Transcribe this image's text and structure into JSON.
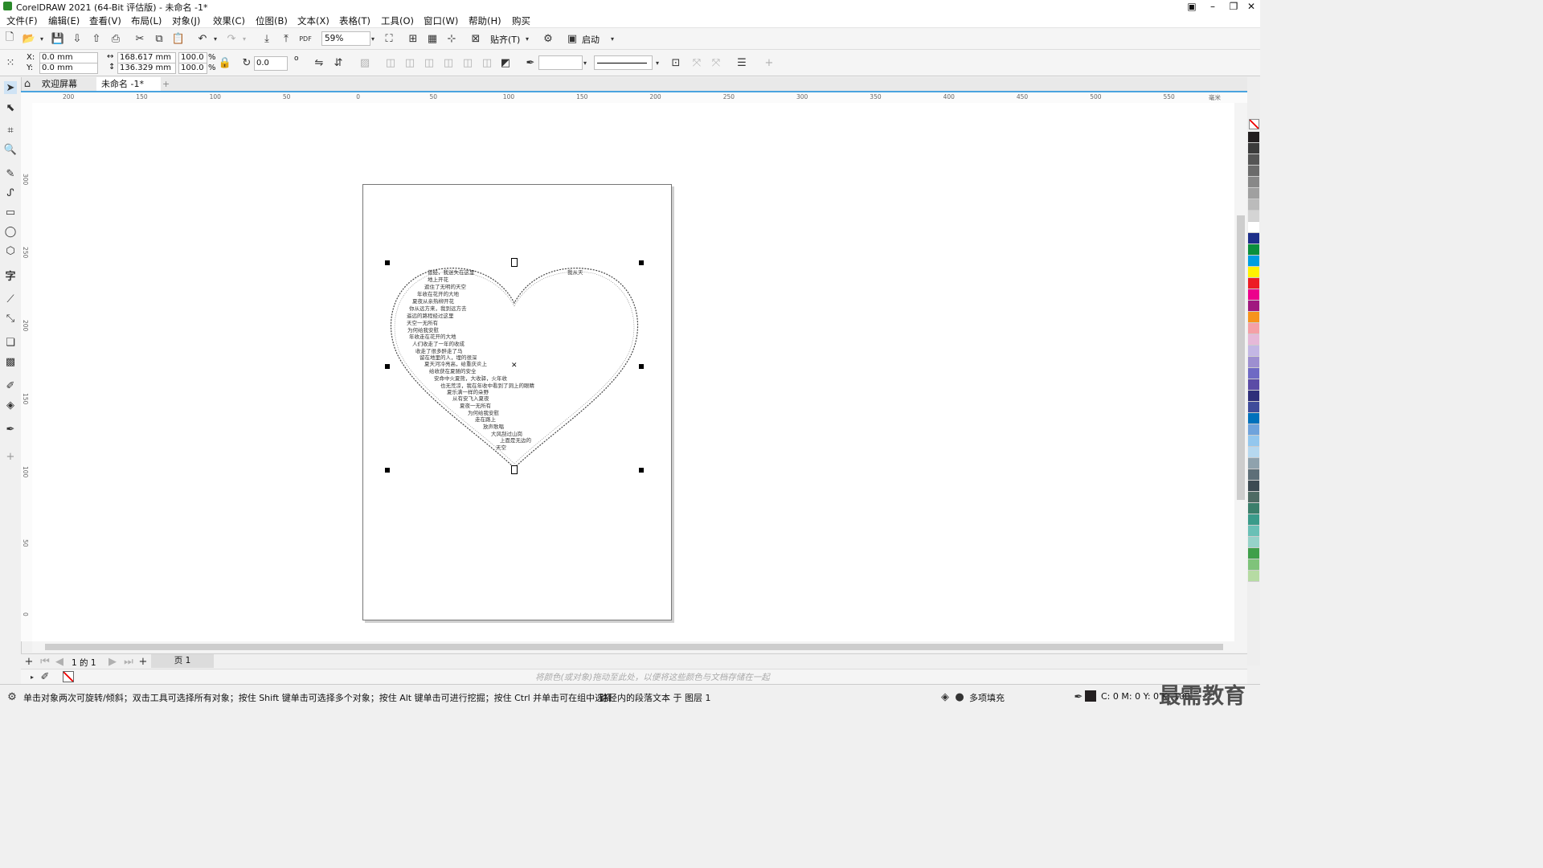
{
  "titlebar": {
    "title": "CorelDRAW 2021 (64-Bit 评估版) - 未命名 -1*"
  },
  "menus": [
    "文件(F)",
    "编辑(E)",
    "查看(V)",
    "布局(L)",
    "对象(J)",
    "效果(C)",
    "位图(B)",
    "文本(X)",
    "表格(T)",
    "工具(O)",
    "窗口(W)",
    "帮助(H)",
    "购买"
  ],
  "toolbar": {
    "zoom": "59%",
    "snap_label": "贴齐(T)",
    "launch_label": "启动"
  },
  "propbar": {
    "x_label": "X:",
    "x_value": "0.0 mm",
    "y_label": "Y:",
    "y_value": "0.0 mm",
    "width_value": "168.617 mm",
    "height_value": "136.329 mm",
    "scale_w": "100.0",
    "scale_h": "100.0",
    "percent": "%",
    "angle": "0.0",
    "degree": "o"
  },
  "tabs": {
    "welcome": "欢迎屏幕",
    "doc": "未命名 -1*",
    "add": "+"
  },
  "hruler_labels": [
    "200",
    "150",
    "100",
    "50",
    "0",
    "50",
    "100",
    "150",
    "200",
    "250",
    "300",
    "350",
    "400",
    "450",
    "500",
    "550",
    "毫米"
  ],
  "vruler_labels": [
    "300",
    "250",
    "200",
    "150",
    "100",
    "50",
    "0"
  ],
  "poem": {
    "lines": [
      "曾经，我迷失在这里",
      "地上开花",
      "遮住了无明的天空",
      "年收在花开的大地",
      "夏夜从亲热柳开花",
      "你从远方来，我到远方去",
      "遥远的路程经过这里",
      "天空一无所有",
      "为何给我安慰",
      "年收走在花开的大地",
      "人们收走了一年的收成",
      "收走了很多醉走了马",
      "留在地里的人，埋的很深",
      "夏天河冷亮高，给重庆炎上",
      "给收获在夏随的安全",
      "安命中火夏熊，大收驿，火年收",
      "也无荒凉，我在年收中看到了洞上的眼睛",
      "夏乐满一样的朵野",
      "从有安飞入夏夜",
      "夏夜一无所有",
      "为何给我安慰",
      "走在路上",
      "放声歌唱",
      "大风刮过山岗",
      "上面是无边的",
      "天空"
    ],
    "top_right": "我从天"
  },
  "pagenav": {
    "page_of": "1 的 1",
    "page_tab": "页 1"
  },
  "colorbar": {
    "hint": "将颜色(或对象)拖动至此处，以便将这些颜色与文档存储在一起"
  },
  "status": {
    "hint": "单击对象两次可旋转/倾斜；双击工具可选择所有对象；按住 Shift 键单击可选择多个对象；按住 Alt 键单击可进行挖掘；按住 Ctrl 并单击可在组中选择",
    "object_info": "路径内的段落文本 于 图层 1",
    "fill_label": "多项填充",
    "cmyk": "C: 0 M: 0 Y: 0 K: 100",
    "watermark": "最需教育"
  },
  "palette_colors": [
    "#231f20",
    "#3b3b3b",
    "#555",
    "#6b6b6b",
    "#888",
    "#a0a0a0",
    "#bbb",
    "#d4d4d4",
    "#fff",
    "#1d2f8a",
    "#0a8f3c",
    "#009ee0",
    "#fff200",
    "#ed1c24",
    "#ec008c",
    "#a0197f",
    "#f7941d",
    "#f5a0a6",
    "#e6b9d8",
    "#c3b7e4",
    "#9d8fd0",
    "#6f69c4",
    "#5b4ba6",
    "#2f2f7a",
    "#3f4c9a",
    "#0071bc",
    "#6fa3dc",
    "#93c7ee",
    "#b6d8ef",
    "#8fa2ad",
    "#5e6f78",
    "#3c4a52",
    "#4f6b64",
    "#3b7f6b",
    "#3a9b8a",
    "#6ac0b6",
    "#96d2c9",
    "#3f9f4a",
    "#7fc37a",
    "#b6dba3"
  ]
}
